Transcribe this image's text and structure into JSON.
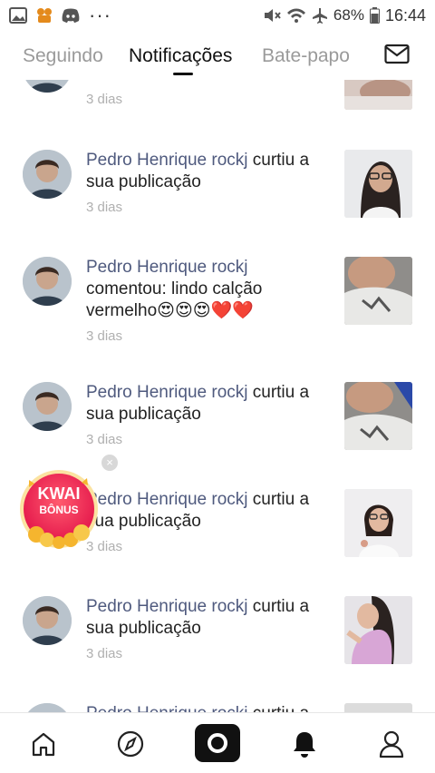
{
  "status_bar": {
    "battery": "68%",
    "time": "16:44",
    "dots": "···"
  },
  "tabs": [
    {
      "label": "Seguindo",
      "active": false
    },
    {
      "label": "Notificações",
      "active": true
    },
    {
      "label": "Bate-papo",
      "active": false
    }
  ],
  "partial_top": {
    "time": "3 dias"
  },
  "notifications": [
    {
      "user": "Pedro Henrique rockj",
      "action": " curtiu a sua publicação",
      "time": "3 dias"
    },
    {
      "user": "Pedro Henrique rockj",
      "action": " comentou: lindo calção vermelho😍😍😍❤️❤️",
      "time": "3 dias"
    },
    {
      "user": "Pedro Henrique rockj",
      "action": " curtiu a sua publicação",
      "time": "3 dias"
    },
    {
      "user": "Pedro Henrique rockj",
      "action": " curtiu a sua publicação",
      "time": "3 dias"
    },
    {
      "user": "Pedro Henrique rockj",
      "action": " curtiu a sua publicação",
      "time": "3 dias"
    },
    {
      "user": "Pedro Henrique rockj",
      "action": " curtiu a",
      "time": ""
    }
  ],
  "kwai_bonus": {
    "line1": "KWAI",
    "line2": "BÔNUS",
    "close": "×"
  },
  "bottom_nav": [
    "home-icon",
    "discover-icon",
    "camera-icon",
    "bell-icon",
    "profile-icon"
  ],
  "colors": {
    "username": "#4f5a7e",
    "time": "#b0b0b0",
    "kwai": "#f0245c"
  }
}
